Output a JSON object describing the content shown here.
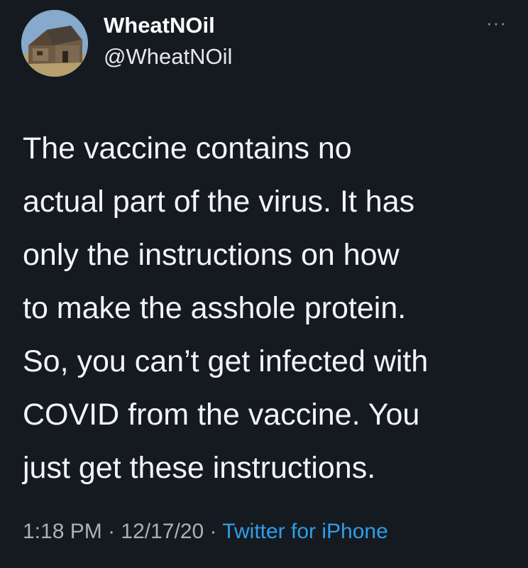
{
  "author": {
    "display_name": "WheatNOil",
    "handle": "@WheatNOil",
    "avatar_icon": "barn-avatar"
  },
  "menu": {
    "more_label": "···"
  },
  "tweet": {
    "lines": [
      "The vaccine contains no",
      "actual part of the virus. It has",
      "only the instructions on how",
      "to make the asshole protein.",
      "So, you can’t get infected with",
      "COVID from the vaccine. You",
      "just get these instructions."
    ]
  },
  "meta": {
    "time": "1:18 PM",
    "separator": " · ",
    "date": "12/17/20",
    "source": "Twitter for iPhone"
  },
  "colors": {
    "background": "#151a21",
    "link": "#2f9ee8",
    "meta_text": "#a9b0b8"
  }
}
